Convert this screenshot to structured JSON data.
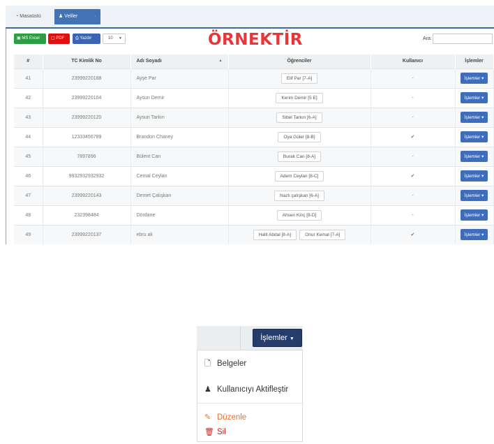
{
  "tabs": [
    {
      "label": "Masaüstü",
      "icon": "dashboard-icon"
    },
    {
      "label": "Veliler",
      "icon": "users-icon",
      "active": true
    }
  ],
  "toolbar": {
    "excel_label": "MS Excel",
    "pdf_label": "PDF",
    "print_label": "Yazdır",
    "page_size": "10",
    "search_label": "Ara:",
    "search_value": ""
  },
  "watermark": "ÖRNEKTİR",
  "table": {
    "headers": [
      "#",
      "TC Kimlik No",
      "Adı Soyadı",
      "Öğrenciler",
      "Kullanıcı",
      "İşlemler"
    ],
    "rows": [
      {
        "no": "41",
        "tc": "23999220188",
        "name": "Ayşe Par",
        "students": [
          "Elif Par [7-A]"
        ],
        "user": "-",
        "action": "İşlemler"
      },
      {
        "no": "42",
        "tc": "23999220104",
        "name": "Aysun Demir",
        "students": [
          "Kerim Demir [5 E]"
        ],
        "user": "-",
        "action": "İşlemler"
      },
      {
        "no": "43",
        "tc": "23999220120",
        "name": "Aysun Tarkın",
        "students": [
          "Sibel Tarkın [6-A]"
        ],
        "user": "-",
        "action": "İşlemler"
      },
      {
        "no": "44",
        "tc": "12333456789",
        "name": "Brandon Chaney",
        "students": [
          "Oya Güler [8-B]"
        ],
        "user": "✔",
        "action": "İşlemler"
      },
      {
        "no": "45",
        "tc": "7897896",
        "name": "Bülent Can",
        "students": [
          "Burak Can [8-A]"
        ],
        "user": "-",
        "action": "İşlemler"
      },
      {
        "no": "46",
        "tc": "9932932932932",
        "name": "Cemal Ceylan",
        "students": [
          "Adem Ceylan [8-C]"
        ],
        "user": "✔",
        "action": "İşlemler"
      },
      {
        "no": "47",
        "tc": "23999220143",
        "name": "Demet Çalışkan",
        "students": [
          "Nazlı çalışkan [6-A]"
        ],
        "user": "-",
        "action": "İşlemler"
      },
      {
        "no": "48",
        "tc": "232398484",
        "name": "Dördane",
        "students": [
          "Ahsen Kılıç [8-D]"
        ],
        "user": "-",
        "action": "İşlemler"
      },
      {
        "no": "49",
        "tc": "23999220137",
        "name": "ebru ak",
        "students": [
          "Halit Abdal [8-A]",
          "Onur Kemal [7-A]"
        ],
        "user": "✔",
        "action": "İşlemler"
      }
    ]
  },
  "dropdown": {
    "button_label": "İşlemler",
    "items": [
      {
        "label": "Belgeler",
        "icon": "document-icon"
      },
      {
        "label": "Kullanıcıyı Aktifleştir",
        "icon": "user-icon"
      },
      {
        "label": "Düzenle",
        "icon": "edit-icon",
        "color": "#e8732a"
      },
      {
        "label": "Sil",
        "icon": "trash-icon",
        "color": "#d32020"
      }
    ]
  },
  "colors": {
    "primary": "#3f6dbd",
    "excel": "#2e9e44",
    "pdf": "#e01010",
    "watermark": "#e8353a",
    "dropdown_button": "#263c6b"
  }
}
